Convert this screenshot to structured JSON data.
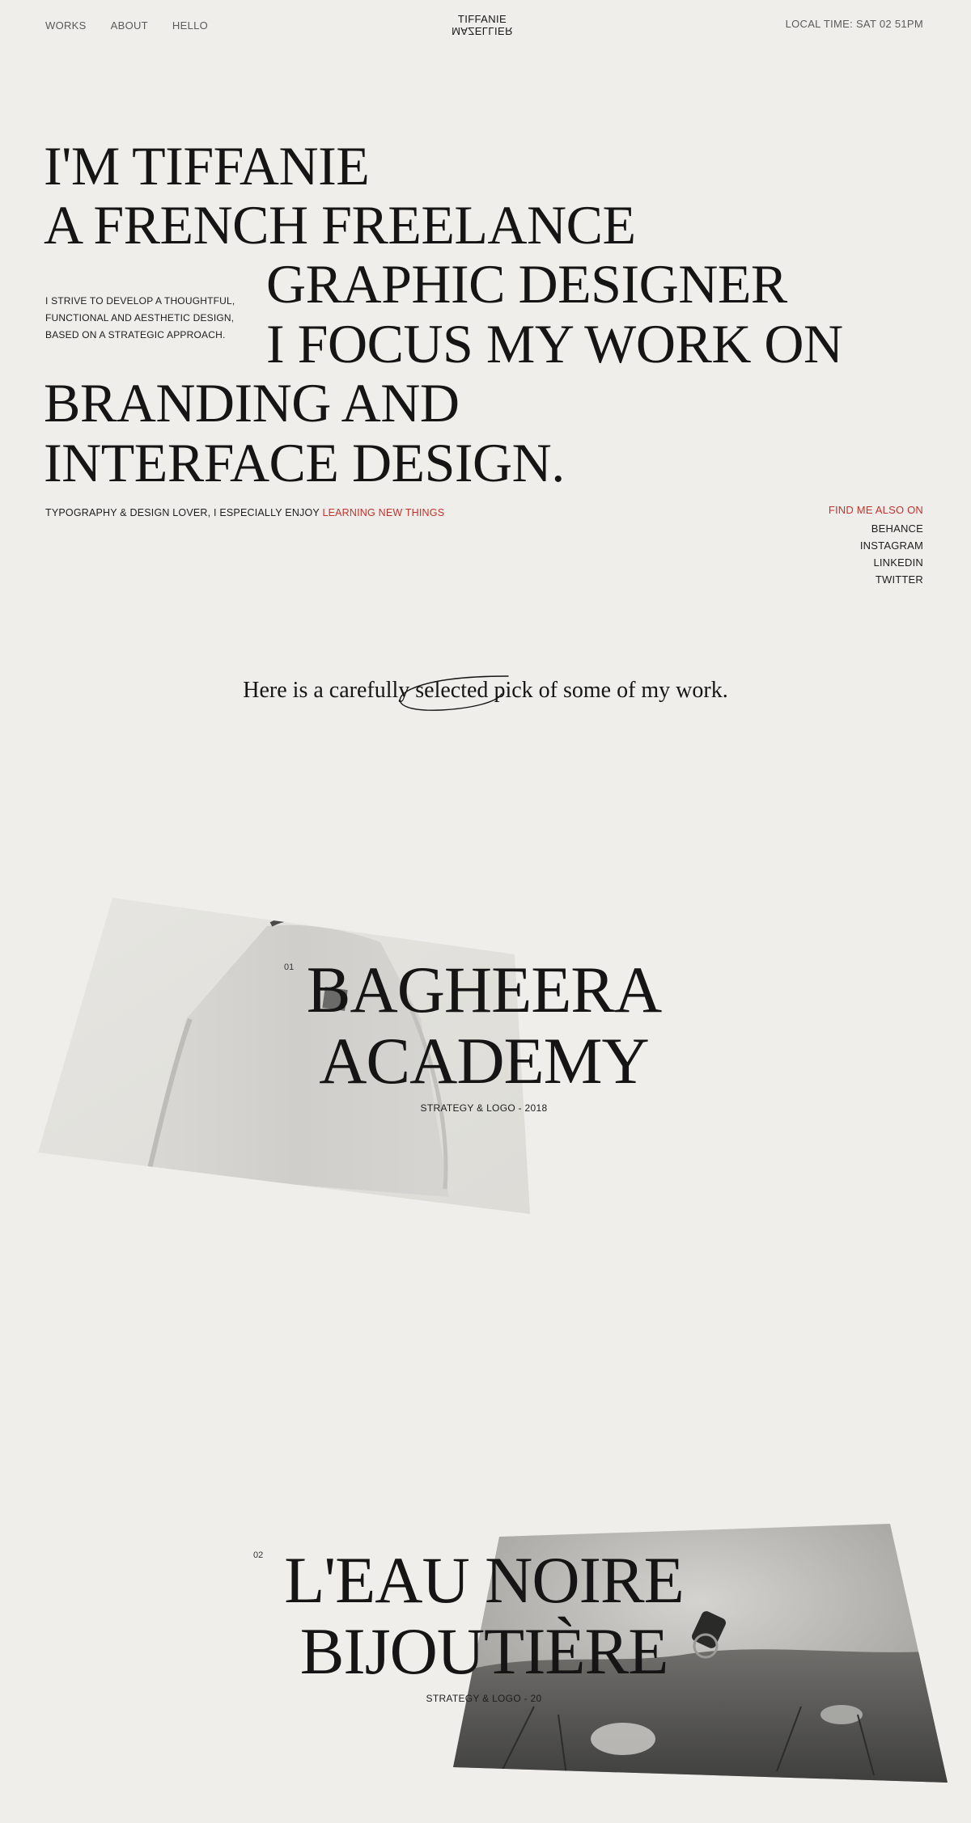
{
  "header": {
    "nav": [
      "WORKS",
      "ABOUT",
      "HELLO"
    ],
    "logo_top": "TIFFANIE",
    "logo_bottom": "MAZELLIER",
    "local_time": "LOCAL TIME: SAT 02 51PM"
  },
  "hero": {
    "line1": "I'M TIFFANIE",
    "line2": "A FRENCH FREELANCE",
    "line3": "GRAPHIC DESIGNER",
    "line4": "I FOCUS MY WORK ON",
    "line5": "BRANDING AND",
    "line6": "INTERFACE DESIGN.",
    "intro": [
      "I STRIVE TO DEVELOP A THOUGHTFUL,",
      "FUNCTIONAL AND AESTHETIC DESIGN,",
      "BASED ON A STRATEGIC APPROACH."
    ],
    "tagline": "TYPOGRAPHY & DESIGN LOVER, I ESPECIALLY ENJOY",
    "tagline_accent": "LEARNING NEW THINGS"
  },
  "social": {
    "title": "FIND ME ALSO ON",
    "links": [
      "BEHANCE",
      "INSTAGRAM",
      "LINKEDIN",
      "TWITTER"
    ]
  },
  "pick": {
    "text_before": "Here is a carefully ",
    "highlight": "selected",
    "text_after": " pick of some of my work."
  },
  "projects": [
    {
      "number": "01",
      "title_line1": "BAGHEERA",
      "title_line2": "ACADEMY",
      "subtitle": "STRATEGY & LOGO - 2018"
    },
    {
      "number": "02",
      "title_line1": "L'EAU NOIRE",
      "title_line2": "BIJOUTIÈRE",
      "subtitle": "STRATEGY & LOGO - 20"
    }
  ],
  "colors": {
    "background": "#efeeea",
    "text": "#151515",
    "accent": "#c8322c"
  }
}
